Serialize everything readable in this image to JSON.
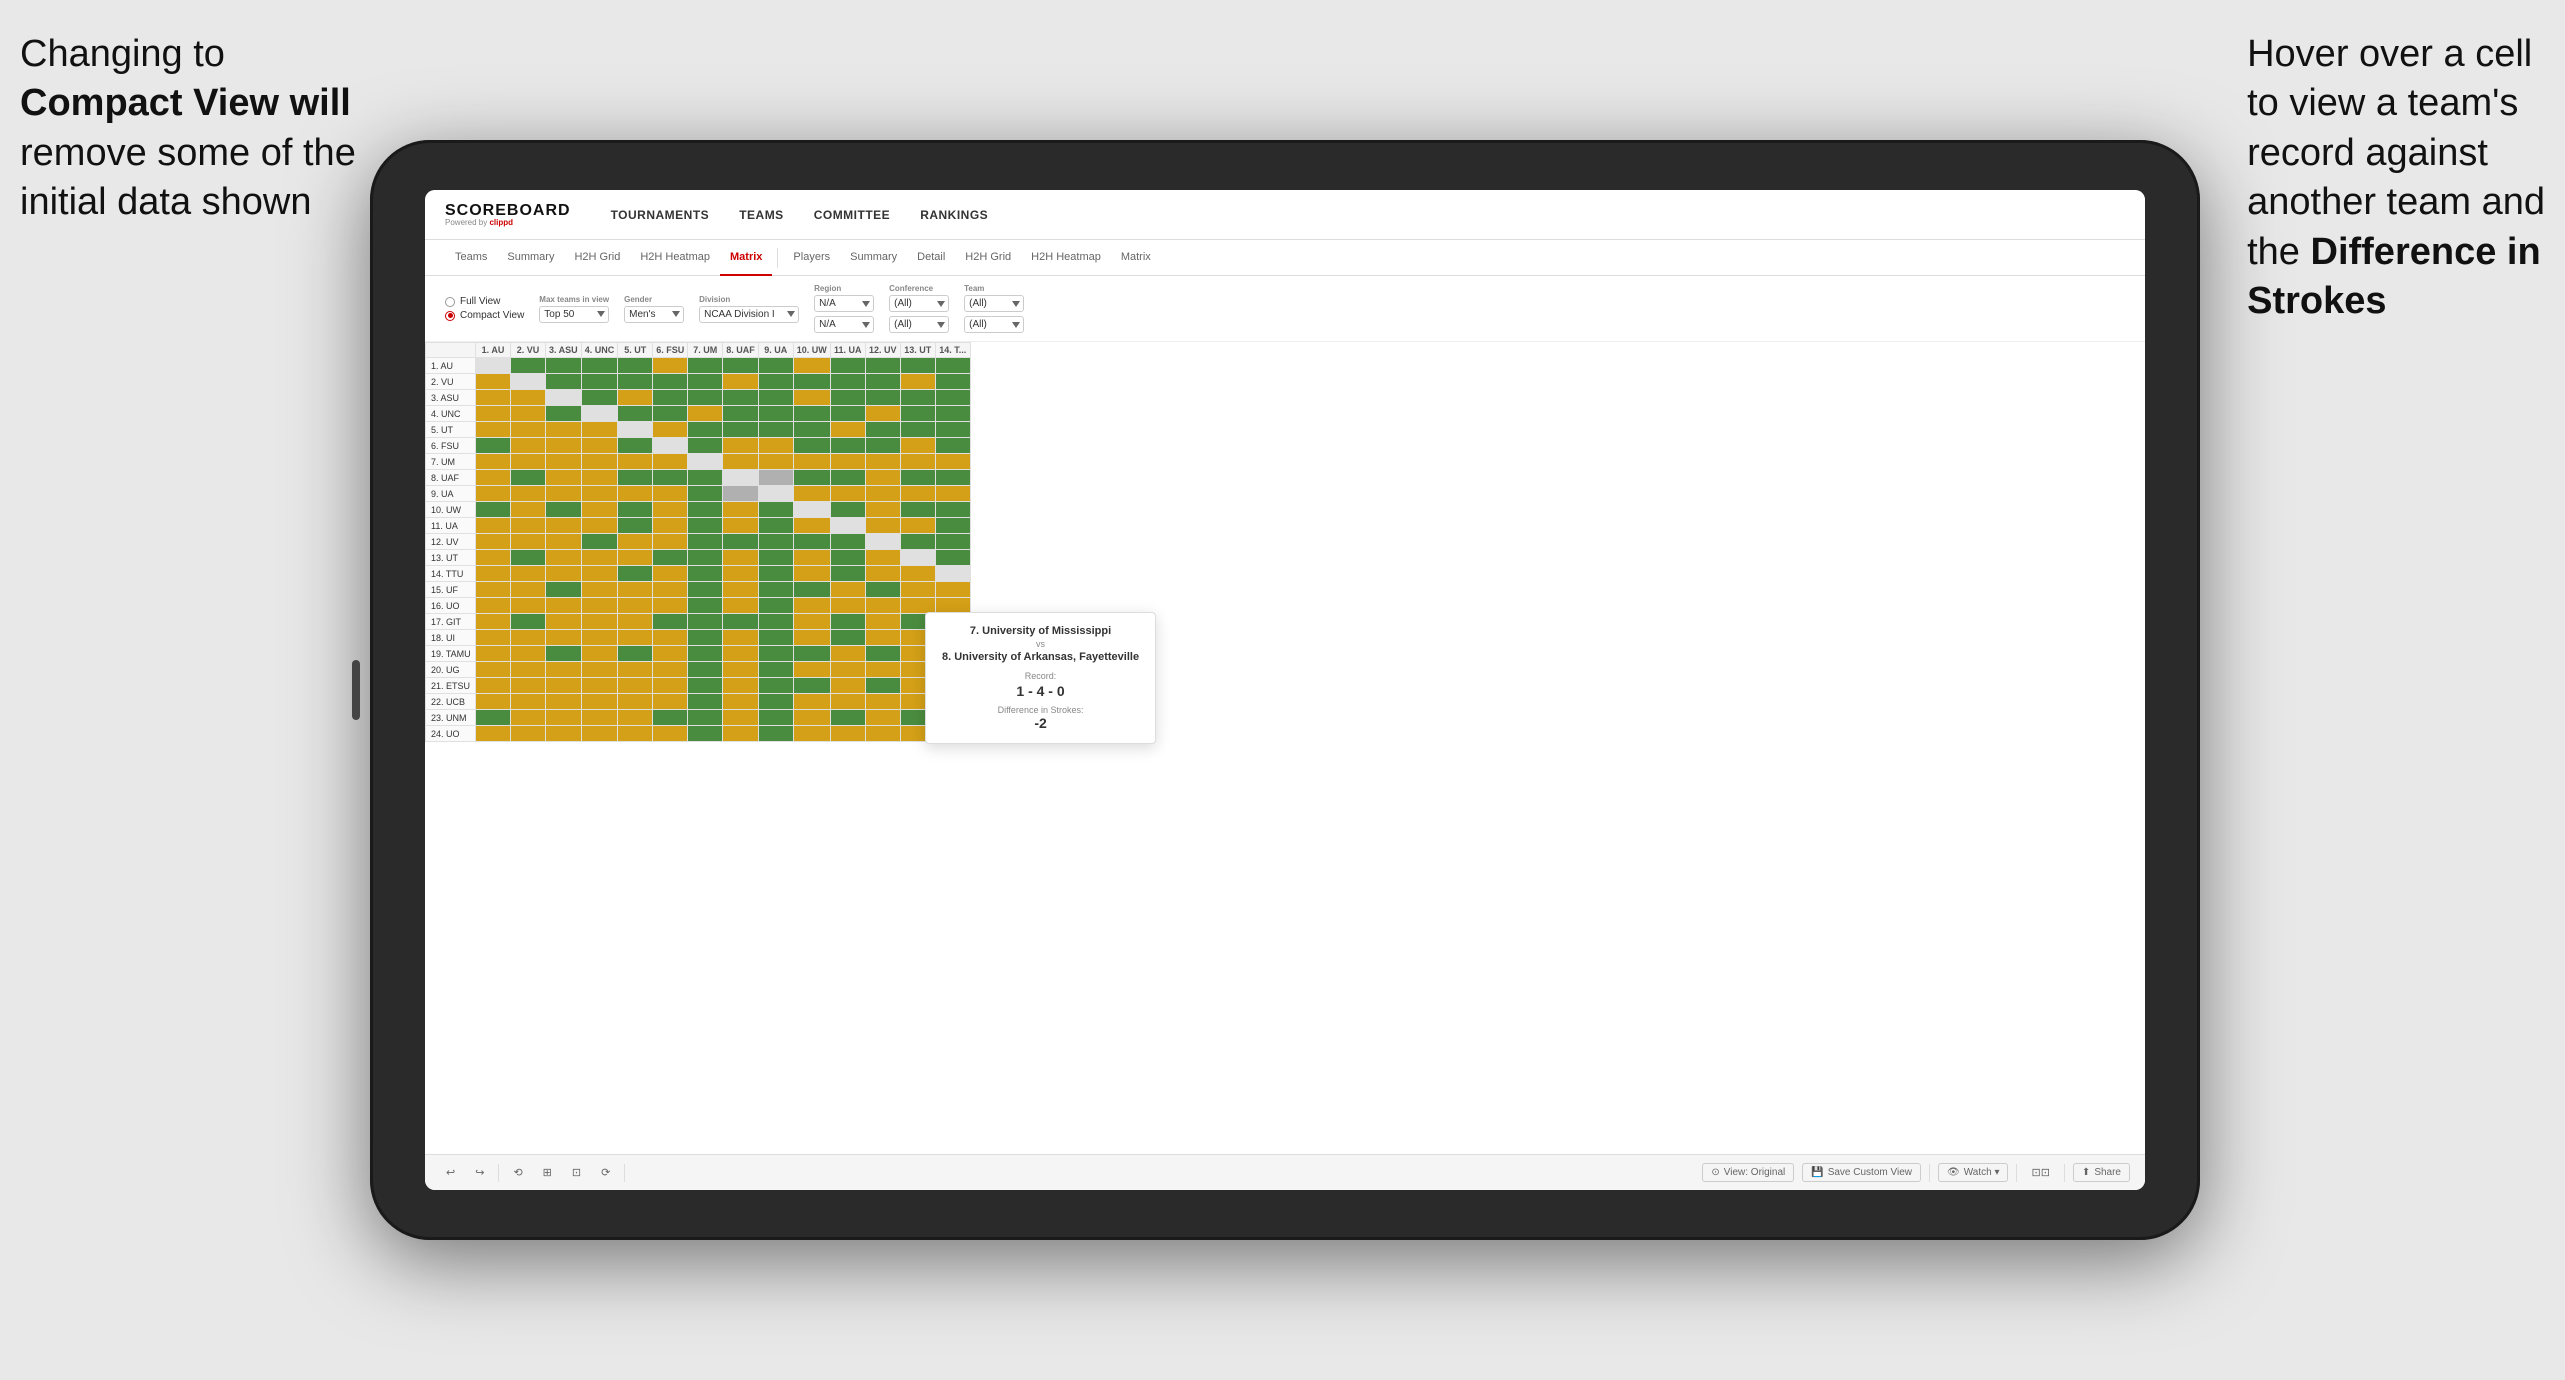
{
  "annotations": {
    "left": {
      "line1": "Changing to",
      "line2": "Compact View will",
      "line3": "remove some of the",
      "line4": "initial data shown"
    },
    "right": {
      "line1": "Hover over a cell",
      "line2": "to view a team's",
      "line3": "record against",
      "line4": "another team and",
      "line5": "the ",
      "line5bold": "Difference in",
      "line6bold": "Strokes"
    }
  },
  "header": {
    "logo": "SCOREBOARD",
    "logo_sub": "Powered by clippd",
    "nav": [
      "TOURNAMENTS",
      "TEAMS",
      "COMMITTEE",
      "RANKINGS"
    ]
  },
  "sub_nav": {
    "group1": [
      "Teams",
      "Summary",
      "H2H Grid",
      "H2H Heatmap",
      "Matrix"
    ],
    "group2": [
      "Players",
      "Summary",
      "Detail",
      "H2H Grid",
      "H2H Heatmap",
      "Matrix"
    ],
    "active": "Matrix"
  },
  "controls": {
    "view_options": [
      "Full View",
      "Compact View"
    ],
    "selected_view": "Compact View",
    "filters": [
      {
        "label": "Max teams in view",
        "value": "Top 50"
      },
      {
        "label": "Gender",
        "value": "Men's"
      },
      {
        "label": "Division",
        "value": "NCAA Division I"
      },
      {
        "label": "Region",
        "value": "N/A"
      },
      {
        "label": "Conference",
        "value": "(All)"
      },
      {
        "label": "Team",
        "value": "(All)"
      }
    ]
  },
  "matrix": {
    "col_headers": [
      "1. AU",
      "2. VU",
      "3. ASU",
      "4. UNC",
      "5. UT",
      "6. FSU",
      "7. UM",
      "8. UAF",
      "9. UA",
      "10. UW",
      "11. UA",
      "12. UV",
      "13. UT",
      "14. T..."
    ],
    "rows": [
      {
        "label": "1. AU",
        "cells": [
          "self",
          "g",
          "g",
          "g",
          "g",
          "y",
          "g",
          "g",
          "g",
          "y",
          "g",
          "g",
          "g",
          "g"
        ]
      },
      {
        "label": "2. VU",
        "cells": [
          "y",
          "self",
          "g",
          "g",
          "g",
          "g",
          "g",
          "y",
          "g",
          "g",
          "g",
          "g",
          "y",
          "g"
        ]
      },
      {
        "label": "3. ASU",
        "cells": [
          "y",
          "y",
          "self",
          "g",
          "y",
          "g",
          "g",
          "g",
          "g",
          "y",
          "g",
          "g",
          "g",
          "g"
        ]
      },
      {
        "label": "4. UNC",
        "cells": [
          "y",
          "y",
          "g",
          "self",
          "g",
          "g",
          "y",
          "g",
          "g",
          "g",
          "g",
          "y",
          "g",
          "g"
        ]
      },
      {
        "label": "5. UT",
        "cells": [
          "y",
          "y",
          "y",
          "y",
          "self",
          "y",
          "g",
          "g",
          "g",
          "g",
          "y",
          "g",
          "g",
          "g"
        ]
      },
      {
        "label": "6. FSU",
        "cells": [
          "g",
          "y",
          "y",
          "y",
          "g",
          "self",
          "g",
          "y",
          "y",
          "g",
          "g",
          "g",
          "y",
          "g"
        ]
      },
      {
        "label": "7. UM",
        "cells": [
          "y",
          "y",
          "y",
          "y",
          "y",
          "y",
          "self",
          "y",
          "y",
          "y",
          "y",
          "y",
          "y",
          "y"
        ]
      },
      {
        "label": "8. UAF",
        "cells": [
          "y",
          "g",
          "y",
          "y",
          "g",
          "g",
          "g",
          "self",
          "gr",
          "g",
          "g",
          "y",
          "g",
          "g"
        ]
      },
      {
        "label": "9. UA",
        "cells": [
          "y",
          "y",
          "y",
          "y",
          "y",
          "y",
          "g",
          "gr",
          "self",
          "y",
          "y",
          "y",
          "y",
          "y"
        ]
      },
      {
        "label": "10. UW",
        "cells": [
          "g",
          "y",
          "g",
          "y",
          "g",
          "y",
          "g",
          "y",
          "g",
          "self",
          "g",
          "y",
          "g",
          "g"
        ]
      },
      {
        "label": "11. UA",
        "cells": [
          "y",
          "y",
          "y",
          "y",
          "g",
          "y",
          "g",
          "y",
          "g",
          "y",
          "self",
          "y",
          "y",
          "g"
        ]
      },
      {
        "label": "12. UV",
        "cells": [
          "y",
          "y",
          "y",
          "g",
          "y",
          "y",
          "g",
          "g",
          "g",
          "g",
          "g",
          "self",
          "g",
          "g"
        ]
      },
      {
        "label": "13. UT",
        "cells": [
          "y",
          "g",
          "y",
          "y",
          "y",
          "g",
          "g",
          "y",
          "g",
          "y",
          "g",
          "y",
          "self",
          "g"
        ]
      },
      {
        "label": "14. TTU",
        "cells": [
          "y",
          "y",
          "y",
          "y",
          "g",
          "y",
          "g",
          "y",
          "g",
          "y",
          "g",
          "y",
          "y",
          "self"
        ]
      },
      {
        "label": "15. UF",
        "cells": [
          "y",
          "y",
          "g",
          "y",
          "y",
          "y",
          "g",
          "y",
          "g",
          "g",
          "y",
          "g",
          "y",
          "y"
        ]
      },
      {
        "label": "16. UO",
        "cells": [
          "y",
          "y",
          "y",
          "y",
          "y",
          "y",
          "g",
          "y",
          "g",
          "y",
          "y",
          "y",
          "y",
          "y"
        ]
      },
      {
        "label": "17. GIT",
        "cells": [
          "y",
          "g",
          "y",
          "y",
          "y",
          "g",
          "g",
          "g",
          "g",
          "y",
          "g",
          "y",
          "g",
          "g"
        ]
      },
      {
        "label": "18. UI",
        "cells": [
          "y",
          "y",
          "y",
          "y",
          "y",
          "y",
          "g",
          "y",
          "g",
          "y",
          "g",
          "y",
          "y",
          "y"
        ]
      },
      {
        "label": "19. TAMU",
        "cells": [
          "y",
          "y",
          "g",
          "y",
          "g",
          "y",
          "g",
          "y",
          "g",
          "g",
          "y",
          "g",
          "y",
          "g"
        ]
      },
      {
        "label": "20. UG",
        "cells": [
          "y",
          "y",
          "y",
          "y",
          "y",
          "y",
          "g",
          "y",
          "g",
          "y",
          "y",
          "y",
          "y",
          "y"
        ]
      },
      {
        "label": "21. ETSU",
        "cells": [
          "y",
          "y",
          "y",
          "y",
          "y",
          "y",
          "g",
          "y",
          "g",
          "g",
          "y",
          "g",
          "y",
          "g"
        ]
      },
      {
        "label": "22. UCB",
        "cells": [
          "y",
          "y",
          "y",
          "y",
          "y",
          "y",
          "g",
          "y",
          "g",
          "y",
          "y",
          "y",
          "y",
          "y"
        ]
      },
      {
        "label": "23. UNM",
        "cells": [
          "g",
          "y",
          "y",
          "y",
          "y",
          "g",
          "g",
          "y",
          "g",
          "y",
          "g",
          "y",
          "g",
          "g"
        ]
      },
      {
        "label": "24. UO",
        "cells": [
          "y",
          "y",
          "y",
          "y",
          "y",
          "y",
          "g",
          "y",
          "g",
          "y",
          "y",
          "y",
          "y",
          "y"
        ]
      }
    ]
  },
  "tooltip": {
    "team1": "7. University of Mississippi",
    "vs": "vs",
    "team2": "8. University of Arkansas, Fayetteville",
    "record_label": "Record:",
    "record": "1 - 4 - 0",
    "diff_label": "Difference in Strokes:",
    "diff": "-2"
  },
  "bottom_toolbar": {
    "buttons": [
      "↩",
      "↪",
      "⟲",
      "⊞",
      "⊡",
      "⟳"
    ],
    "view_original": "View: Original",
    "save_custom": "Save Custom View",
    "watch": "Watch ▾",
    "share": "Share"
  }
}
